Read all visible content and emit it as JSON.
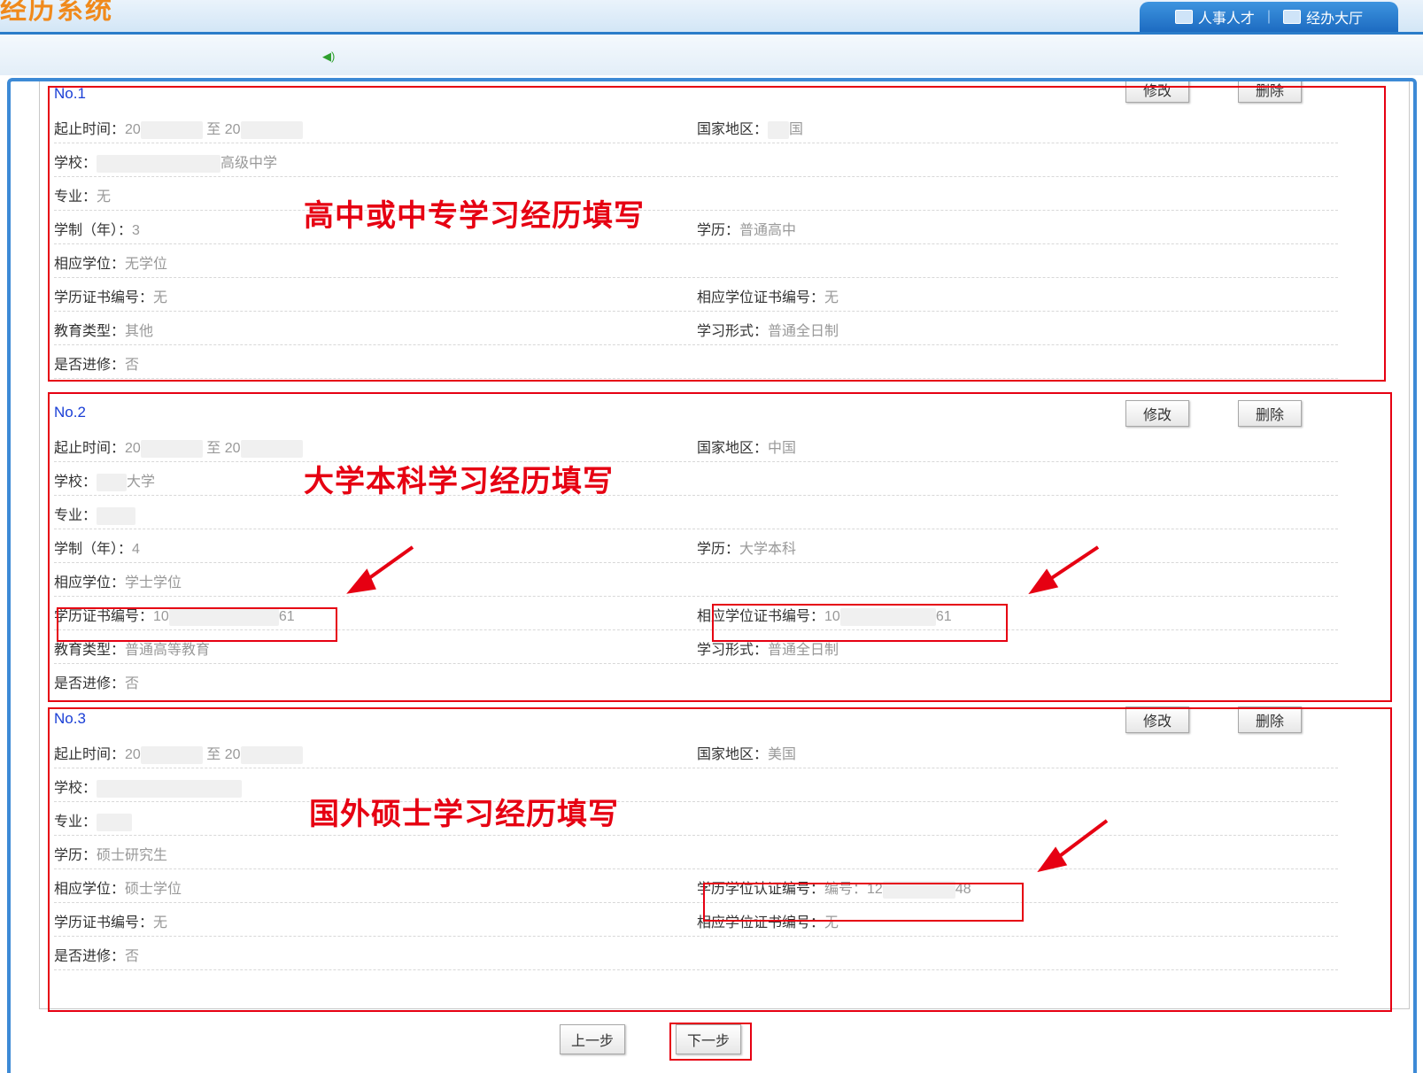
{
  "header": {
    "logo_text": "经历系统",
    "nav": [
      {
        "label": "人事人才",
        "icon": "books-icon"
      },
      {
        "label": "经办大厅",
        "icon": "building-icon"
      }
    ]
  },
  "records": [
    {
      "no": "No.1",
      "edit_label": "修改",
      "delete_label": "删除",
      "annotation": "高中或中专学习经历填写",
      "fields": {
        "period_label": "起止时间：",
        "period_start": "20",
        "period_to": "至 20",
        "country_label": "国家地区：",
        "country": "国",
        "school_label": "学校：",
        "school": "高级中学",
        "major_label": "专业：",
        "major": "无",
        "duration_label": "学制（年）：",
        "duration": "3",
        "education_label": "学历：",
        "education": "普通高中",
        "degree_label": "相应学位：",
        "degree": "无学位",
        "edu_cert_label": "学历证书编号：",
        "edu_cert": "无",
        "degree_cert_label": "相应学位证书编号：",
        "degree_cert": "无",
        "edu_type_label": "教育类型：",
        "edu_type": "其他",
        "study_form_label": "学习形式：",
        "study_form": "普通全日制",
        "advanced_label": "是否进修：",
        "advanced": "否"
      }
    },
    {
      "no": "No.2",
      "edit_label": "修改",
      "delete_label": "删除",
      "annotation": "大学本科学习经历填写",
      "fields": {
        "period_label": "起止时间：",
        "period_start": "20",
        "period_to": "至 20",
        "country_label": "国家地区：",
        "country": "中国",
        "school_label": "学校：",
        "school": "大学",
        "major_label": "专业：",
        "major": "",
        "duration_label": "学制（年）：",
        "duration": "4",
        "education_label": "学历：",
        "education": "大学本科",
        "degree_label": "相应学位：",
        "degree": "学士学位",
        "edu_cert_label": "学历证书编号：",
        "edu_cert_start": "10",
        "edu_cert_end": "61",
        "degree_cert_label": "相应学位证书编号：",
        "degree_cert_start": "10",
        "degree_cert_end": "61",
        "edu_type_label": "教育类型：",
        "edu_type": "普通高等教育",
        "study_form_label": "学习形式：",
        "study_form": "普通全日制",
        "advanced_label": "是否进修：",
        "advanced": "否"
      }
    },
    {
      "no": "No.3",
      "edit_label": "修改",
      "delete_label": "删除",
      "annotation": "国外硕士学习经历填写",
      "fields": {
        "period_label": "起止时间：",
        "period_start": "20",
        "period_to": "至 20",
        "country_label": "国家地区：",
        "country": "美国",
        "school_label": "学校：",
        "major_label": "专业：",
        "education_label": "学历：",
        "education": "硕士研究生",
        "degree_label": "相应学位：",
        "degree": "硕士学位",
        "cert_auth_label": "学历学位认证编号：",
        "cert_auth_prefix": "编号：",
        "cert_auth_start": "12",
        "cert_auth_end": "48",
        "edu_cert_label": "学历证书编号：",
        "edu_cert": "无",
        "degree_cert_label": "相应学位证书编号：",
        "degree_cert": "无",
        "advanced_label": "是否进修：",
        "advanced": "否"
      }
    }
  ],
  "footer": {
    "prev_label": "上一步",
    "next_label": "下一步"
  },
  "colors": {
    "accent_blue": "#2a7cc9",
    "annotation_red": "#e60012",
    "record_no_blue": "#1a3fd6"
  }
}
